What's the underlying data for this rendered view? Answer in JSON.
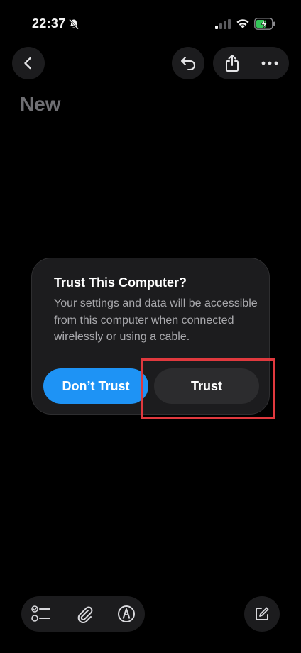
{
  "status_bar": {
    "time": "22:37",
    "icons": [
      "bell-slash-icon",
      "signal-icon",
      "wifi-icon",
      "battery-charging-icon"
    ]
  },
  "nav": {
    "icons": [
      "chevron-left-icon",
      "undo-icon",
      "share-icon",
      "ellipsis-icon"
    ]
  },
  "note": {
    "title": "New"
  },
  "dialog": {
    "title": "Trust This Computer?",
    "message": "Your settings and data will be accessible from this computer when connected wirelessly or using a cable.",
    "dont_trust_label": "Don’t Trust",
    "trust_label": "Trust"
  },
  "toolbar": {
    "icons": [
      "checklist-icon",
      "paperclip-icon",
      "markup-pen-icon",
      "compose-icon"
    ]
  },
  "colors": {
    "background": "#000000",
    "surface": "#1c1c1e",
    "accent_blue": "#1e93f5",
    "highlight_red": "#e0393e",
    "battery_green": "#34c759"
  }
}
